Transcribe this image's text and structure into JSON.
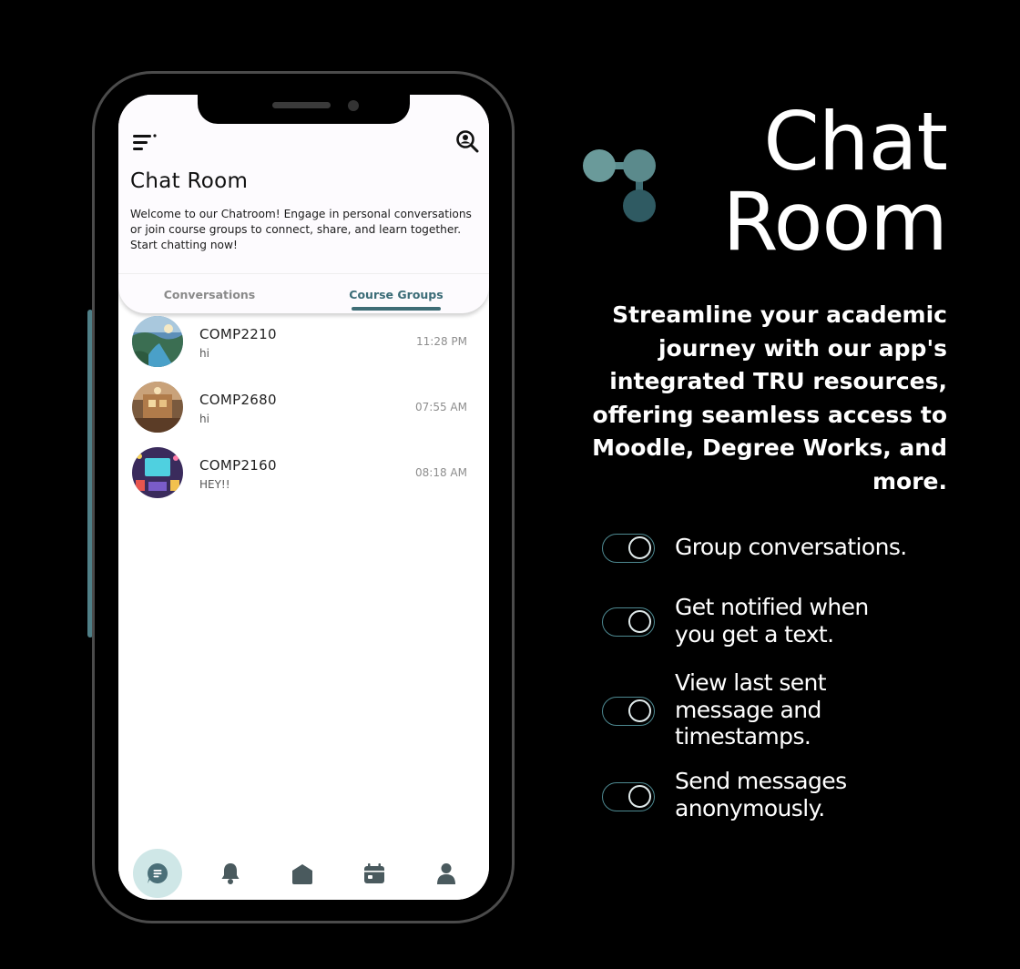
{
  "app": {
    "title": "Chat Room",
    "intro": "Welcome to our Chatroom! Engage in personal conversations or join course groups to connect, share, and learn together. Start chatting now!",
    "tabs": [
      {
        "label": "Conversations",
        "active": false
      },
      {
        "label": "Course Groups",
        "active": true
      }
    ],
    "chats": [
      {
        "name": "COMP2210",
        "last_message": "hi",
        "time": "11:28 PM"
      },
      {
        "name": "COMP2680",
        "last_message": "hi",
        "time": "07:55 AM"
      },
      {
        "name": "COMP2160",
        "last_message": "HEY!!",
        "time": "08:18 AM"
      }
    ],
    "bottom_nav": [
      {
        "icon": "chat-icon",
        "active": true
      },
      {
        "icon": "bell-icon",
        "active": false
      },
      {
        "icon": "home-icon",
        "active": false
      },
      {
        "icon": "calendar-icon",
        "active": false
      },
      {
        "icon": "profile-icon",
        "active": false
      }
    ],
    "header_icons": [
      "menu-icon",
      "search-icon"
    ]
  },
  "promo": {
    "title_line1": "Chat",
    "title_line2": "Room",
    "tagline": "Streamline your academic journey with our app's integrated TRU resources, offering seamless access to Moodle, Degree Works, and more.",
    "features": [
      {
        "text": "Group conversations."
      },
      {
        "text": "Get notified when you get a text."
      },
      {
        "text": "View last sent message and timestamps."
      },
      {
        "text": "Send messages anonymously."
      }
    ]
  },
  "colors": {
    "accent": "#3f6d76",
    "toggle_border": "#4e8a92",
    "nav_active_bg": "#cfe7e7",
    "background": "#000000"
  }
}
